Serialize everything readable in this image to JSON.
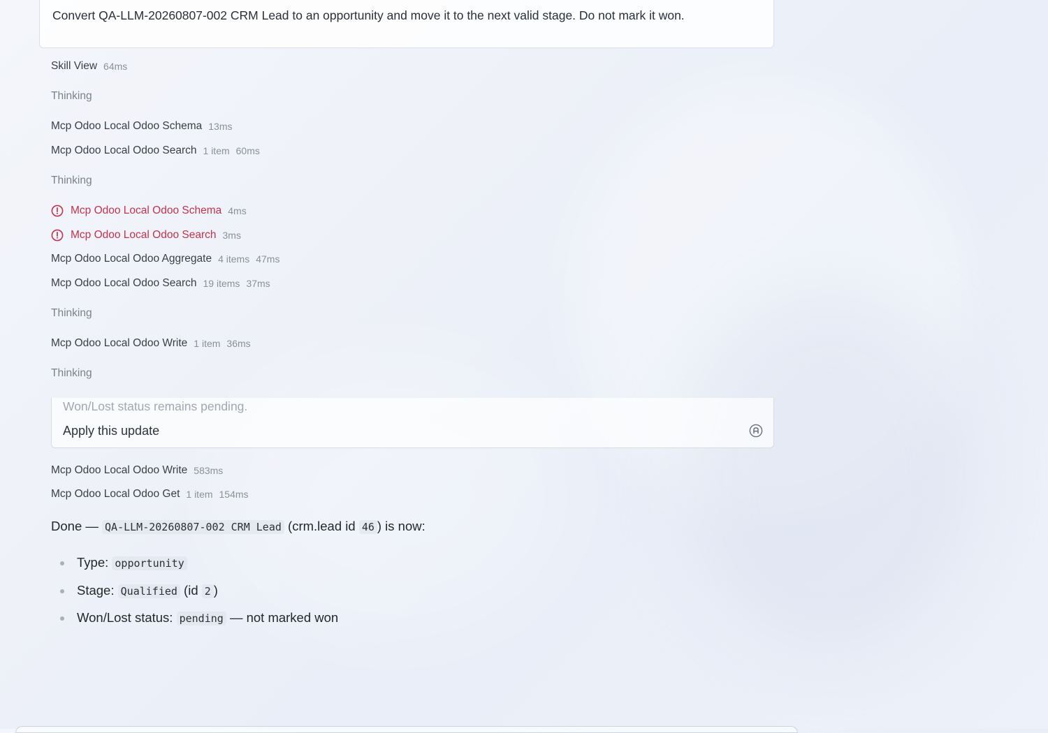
{
  "prompt": {
    "text": "Convert QA-LLM-20260807-002 CRM Lead to an opportunity and move it to the next valid stage. Do not mark it won."
  },
  "steps": [
    {
      "name": "Skill View",
      "status": "ok",
      "meta": [
        "64ms"
      ]
    },
    {
      "name": "Thinking",
      "status": "thinking",
      "meta": []
    },
    {
      "name": "Mcp Odoo Local Odoo Schema",
      "status": "ok",
      "meta": [
        "13ms"
      ]
    },
    {
      "name": "Mcp Odoo Local Odoo Search",
      "status": "ok",
      "meta": [
        "1 item",
        "60ms"
      ]
    },
    {
      "name": "Thinking",
      "status": "thinking",
      "meta": []
    },
    {
      "name": "Mcp Odoo Local Odoo Schema",
      "status": "error",
      "meta": [
        "4ms"
      ]
    },
    {
      "name": "Mcp Odoo Local Odoo Search",
      "status": "error",
      "meta": [
        "3ms"
      ]
    },
    {
      "name": "Mcp Odoo Local Odoo Aggregate",
      "status": "ok",
      "meta": [
        "4 items",
        "47ms"
      ]
    },
    {
      "name": "Mcp Odoo Local Odoo Search",
      "status": "ok",
      "meta": [
        "19 items",
        "37ms"
      ]
    },
    {
      "name": "Thinking",
      "status": "thinking",
      "meta": []
    },
    {
      "name": "Mcp Odoo Local Odoo Write",
      "status": "ok",
      "meta": [
        "1 item",
        "36ms"
      ]
    },
    {
      "name": "Thinking",
      "status": "thinking",
      "meta": []
    },
    {
      "name": "Mcp Odoo Local Odoo Write",
      "status": "ok",
      "meta": [
        "583ms"
      ]
    },
    {
      "name": "Mcp Odoo Local Odoo Get",
      "status": "ok",
      "meta": [
        "1 item",
        "154ms"
      ]
    }
  ],
  "confirm": {
    "muted_text": "Won/Lost status remains pending.",
    "action_label": "Apply this update"
  },
  "summary": {
    "prefix": "Done — ",
    "record": "QA-LLM-20260807-002 CRM Lead",
    "mid": " (crm.lead id ",
    "id": "46",
    "suffix": ") is now:",
    "bullets": [
      {
        "label": "Type: ",
        "code": "opportunity",
        "rest": ""
      },
      {
        "label": "Stage: ",
        "code": "Qualified",
        "rest_pre": " (id ",
        "code2": "2",
        "rest": ")"
      },
      {
        "label": "Won/Lost status: ",
        "code": "pending",
        "rest": " — not marked won"
      }
    ]
  },
  "colors": {
    "error": "#c2334b",
    "muted": "#8a909a",
    "text": "#2b2f36"
  },
  "icons": {
    "error": "alert-circle-icon",
    "confirm": "keyboard-shortcut-icon"
  }
}
